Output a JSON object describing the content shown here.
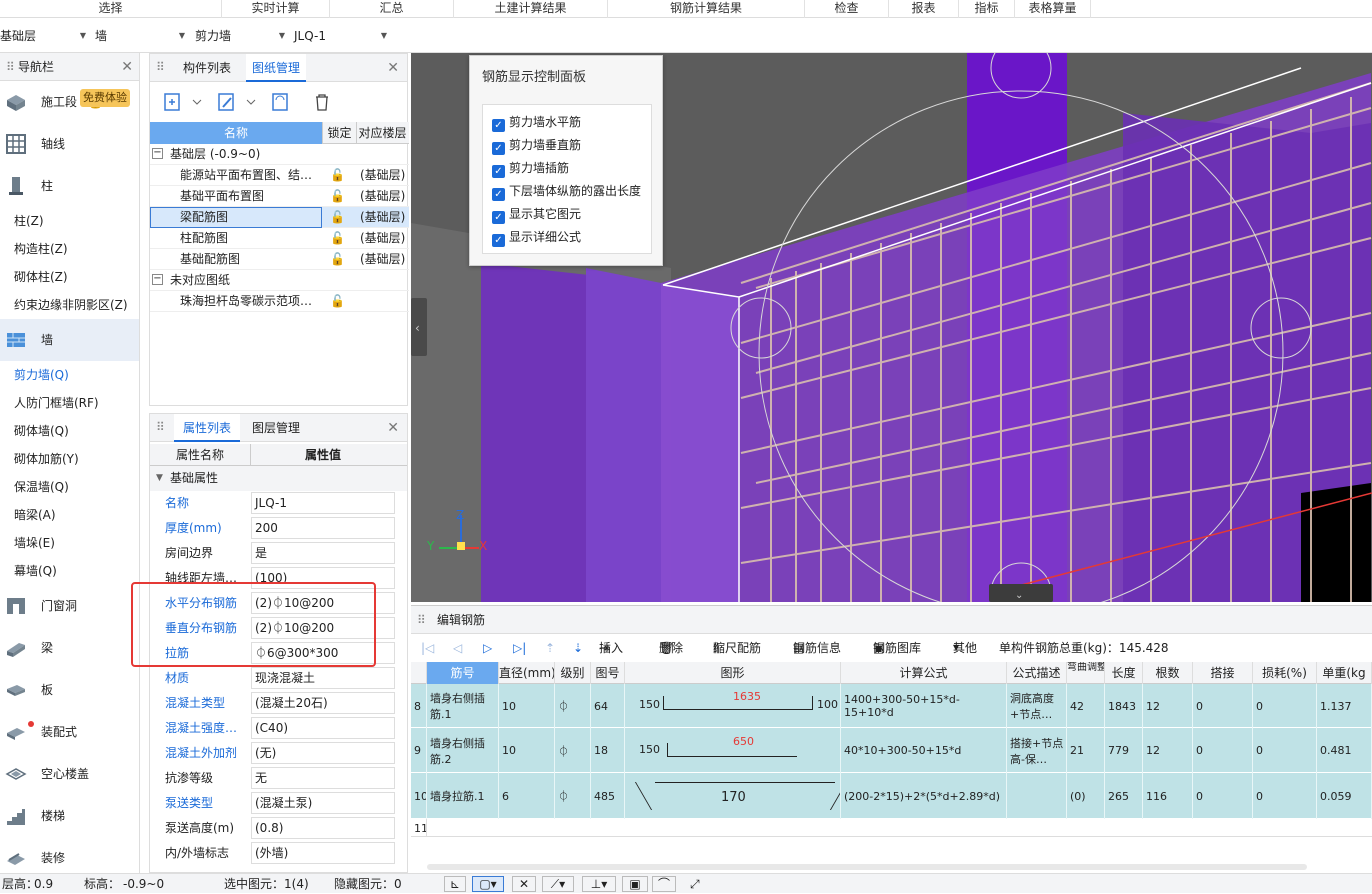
{
  "top_menu": [
    "选择",
    "实时计算",
    "汇总",
    "土建计算结果",
    "钢筋计算结果",
    "检查",
    "报表",
    "指标",
    "表格算量"
  ],
  "combos": {
    "floor": "基础层",
    "type": "墙",
    "subtype": "剪力墙",
    "name": "JLQ-1"
  },
  "nav": {
    "title": "导航栏",
    "badge": "免费体验",
    "big_items": [
      "施工段",
      "轴线",
      "柱"
    ],
    "col_items": [
      "柱(Z)",
      "构造柱(Z)",
      "砌体柱(Z)",
      "约束边缘非阴影区(Z)"
    ],
    "wall_label": "墙",
    "wall_items": [
      "剪力墙(Q)",
      "人防门框墙(RF)",
      "砌体墙(Q)",
      "砌体加筋(Y)",
      "保温墙(Q)",
      "暗梁(A)",
      "墙垛(E)",
      "幕墙(Q)"
    ],
    "lower_items": [
      "门窗洞",
      "梁",
      "板",
      "装配式",
      "空心楼盖",
      "楼梯",
      "装修"
    ]
  },
  "drawing_panel": {
    "tabs": [
      "构件列表",
      "图纸管理"
    ],
    "headers": [
      "名称",
      "锁定",
      "对应楼层"
    ],
    "groups": [
      {
        "label": "基础层 (-0.9~0)",
        "rows": [
          {
            "name": "能源站平面布置图、结…",
            "floor": "(基础层)"
          },
          {
            "name": "基础平面布置图",
            "floor": "(基础层)"
          },
          {
            "name": "梁配筋图",
            "floor": "(基础层)"
          },
          {
            "name": "柱配筋图",
            "floor": "(基础层)"
          },
          {
            "name": "基础配筋图",
            "floor": "(基础层)"
          }
        ]
      },
      {
        "label": "未对应图纸",
        "rows": [
          {
            "name": "珠海担杆岛零碳示范项…",
            "floor": ""
          }
        ]
      }
    ]
  },
  "props": {
    "tabs": [
      "属性列表",
      "图层管理"
    ],
    "headers": [
      "属性名称",
      "属性值"
    ],
    "group": "基础属性",
    "rows": [
      {
        "name": "名称",
        "value": "JLQ-1",
        "blue": true
      },
      {
        "name": "厚度(mm)",
        "value": "200",
        "blue": true
      },
      {
        "name": "房间边界",
        "value": "是",
        "blue": false
      },
      {
        "name": "轴线距左墙…",
        "value": "(100)",
        "blue": false
      },
      {
        "name": "水平分布钢筋",
        "value": "(2)⏀10@200",
        "blue": true
      },
      {
        "name": "垂直分布钢筋",
        "value": "(2)⏀10@200",
        "blue": true
      },
      {
        "name": "拉筋",
        "value": "⏀6@300*300",
        "blue": true
      },
      {
        "name": "材质",
        "value": "现浇混凝土",
        "blue": true
      },
      {
        "name": "混凝土类型",
        "value": "(混凝土20石)",
        "blue": true
      },
      {
        "name": "混凝土强度…",
        "value": "(C40)",
        "blue": true
      },
      {
        "name": "混凝土外加剂",
        "value": "(无)",
        "blue": true
      },
      {
        "name": "抗渗等级",
        "value": "无",
        "blue": false
      },
      {
        "name": "泵送类型",
        "value": "(混凝土泵)",
        "blue": true
      },
      {
        "name": "泵送高度(m)",
        "value": "(0.8)",
        "blue": false
      },
      {
        "name": "内/外墙标志",
        "value": "(外墙)",
        "blue": false
      }
    ]
  },
  "control_panel": {
    "title": "钢筋显示控制面板",
    "items": [
      "剪力墙水平筋",
      "剪力墙垂直筋",
      "剪力墙插筋",
      "下层墙体纵筋的露出长度",
      "显示其它图元",
      "显示详细公式"
    ]
  },
  "rebar": {
    "title": "编辑钢筋",
    "toolbar": {
      "insert": "插入",
      "delete": "删除",
      "scale": "缩尺配筋",
      "info": "钢筋信息",
      "lib": "钢筋图库",
      "other": "其他",
      "total": "单构件钢筋总重(kg)：145.428"
    },
    "headers": [
      "筋号",
      "直径(mm)",
      "级别",
      "图号",
      "图形",
      "计算公式",
      "公式描述",
      "弯曲调整",
      "长度",
      "根数",
      "搭接",
      "损耗(%)",
      "单重(kg"
    ],
    "rows": [
      {
        "idx": "8",
        "name": "墙身右侧插筋.1",
        "dia": "10",
        "grade": "⏀",
        "fig": "64",
        "s_left": "150",
        "s_mid": "1635",
        "s_right": "100",
        "formula": "1400+300-50+15*d-15+10*d",
        "desc": "洞底高度+节点…",
        "bend": "42",
        "len": "1843",
        "count": "12",
        "lap": "0",
        "loss": "0",
        "weight": "1.137"
      },
      {
        "idx": "9",
        "name": "墙身右侧插筋.2",
        "dia": "10",
        "grade": "⏀",
        "fig": "18",
        "s_left": "150",
        "s_mid": "650",
        "s_right": "",
        "formula": "40*10+300-50+15*d",
        "desc": "搭接+节点高-保…",
        "bend": "21",
        "len": "779",
        "count": "12",
        "lap": "0",
        "loss": "0",
        "weight": "0.481"
      },
      {
        "idx": "10",
        "name": "墙身拉筋.1",
        "dia": "6",
        "grade": "⏀",
        "fig": "485",
        "s_left": "",
        "s_mid": "170",
        "s_right": "",
        "formula": "(200-2*15)+2*(5*d+2.89*d)",
        "desc": "",
        "bend": "(0)",
        "len": "265",
        "count": "116",
        "lap": "0",
        "loss": "0",
        "weight": "0.059"
      }
    ],
    "empty_idx": "11"
  },
  "status": {
    "floor_h": "层高：",
    "floor_h_v": "0.9",
    "elev": "标高：",
    "elev_v": "-0.9~0",
    "sel": "选中图元：1(4)",
    "hidden": "隐藏图元：0"
  },
  "colors": {
    "accent": "#1a6ad8",
    "viewport_bg": "#5a5a5a",
    "wall": "#7b3cc4",
    "rebar_row": "#bfe2e6",
    "highlight_box": "#e53935"
  }
}
